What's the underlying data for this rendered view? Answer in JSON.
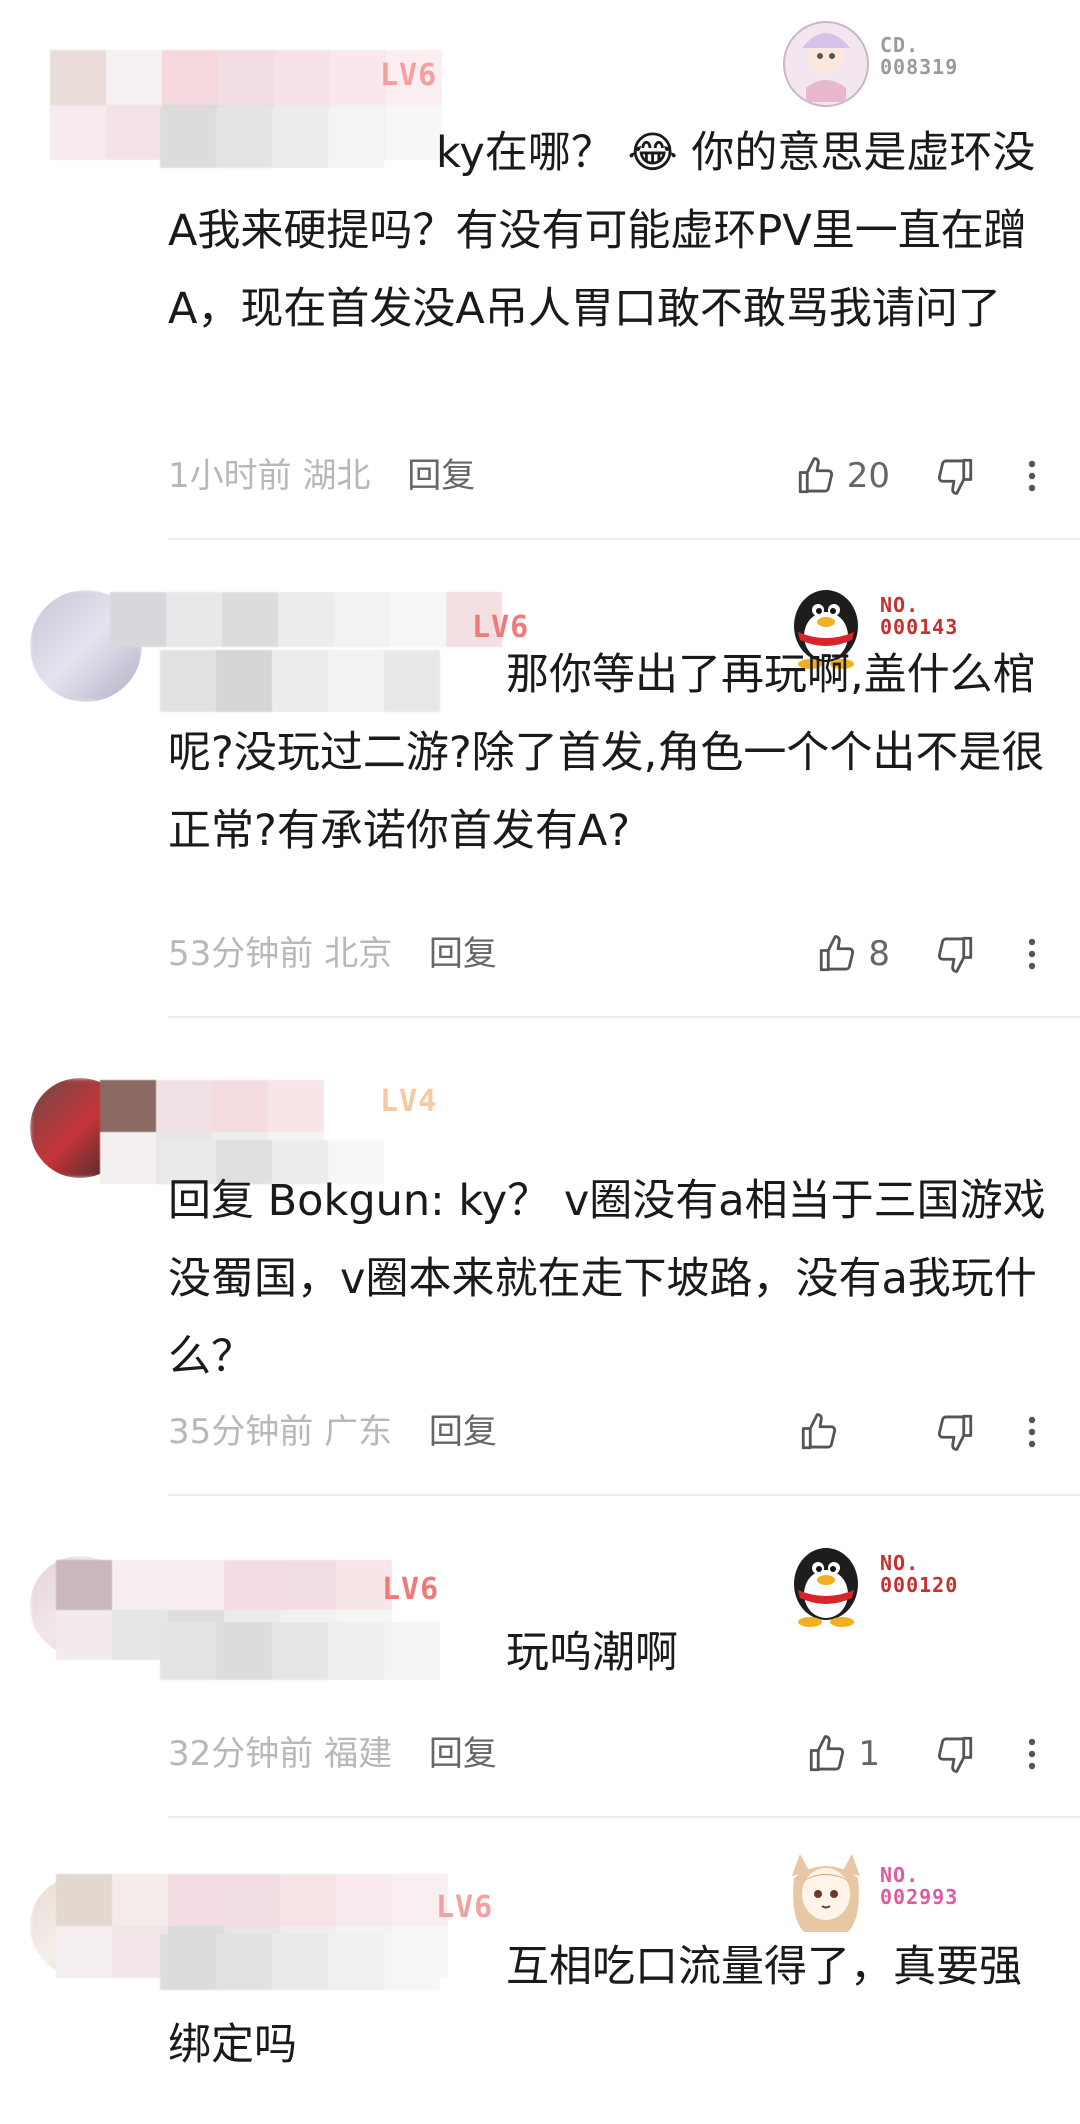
{
  "comments": [
    {
      "level_badge": "LV6",
      "fan_card": {
        "label": "CD.\n008319",
        "color": "#9a9a9a"
      },
      "text": "ky在哪？ 😂 你的意思是虚环没A我来硬提吗？有没有可能虚环PV里一直在蹭A，现在首发没A吊人胃口敢不敢骂我请问了",
      "time": "1小时前",
      "location": "湖北",
      "reply_label": "回复",
      "likes": "20"
    },
    {
      "level_badge": "LV6",
      "fan_card": {
        "label": "NO.\n000143",
        "color": "#c53030"
      },
      "text": "那你等出了再玩啊,盖什么棺呢?没玩过二游?除了首发,角色一个个出不是很正常?有承诺你首发有A?",
      "time": "53分钟前",
      "location": "北京",
      "reply_label": "回复",
      "likes": "8"
    },
    {
      "level_badge": "LV4",
      "fan_card": null,
      "text": "回复 Bokgun: ky？ v圈没有a相当于三国游戏没蜀国，v圈本来就在走下坡路，没有a我玩什么？",
      "time": "35分钟前",
      "location": "广东",
      "reply_label": "回复",
      "likes": ""
    },
    {
      "level_badge": "LV6",
      "fan_card": {
        "label": "NO.\n000120",
        "color": "#c53030"
      },
      "text": "玩呜潮啊",
      "time": "32分钟前",
      "location": "福建",
      "reply_label": "回复",
      "likes": "1"
    },
    {
      "level_badge": "LV6",
      "fan_card": {
        "label": "NO.\n002993",
        "color": "#e05aa0"
      },
      "text": "互相吃口流量得了，真要强绑定吗",
      "time": "",
      "location": "",
      "reply_label": "",
      "likes": ""
    }
  ],
  "icons": {
    "like": "thumbs-up-icon",
    "dislike": "thumbs-down-icon",
    "more": "more-vertical-icon"
  }
}
